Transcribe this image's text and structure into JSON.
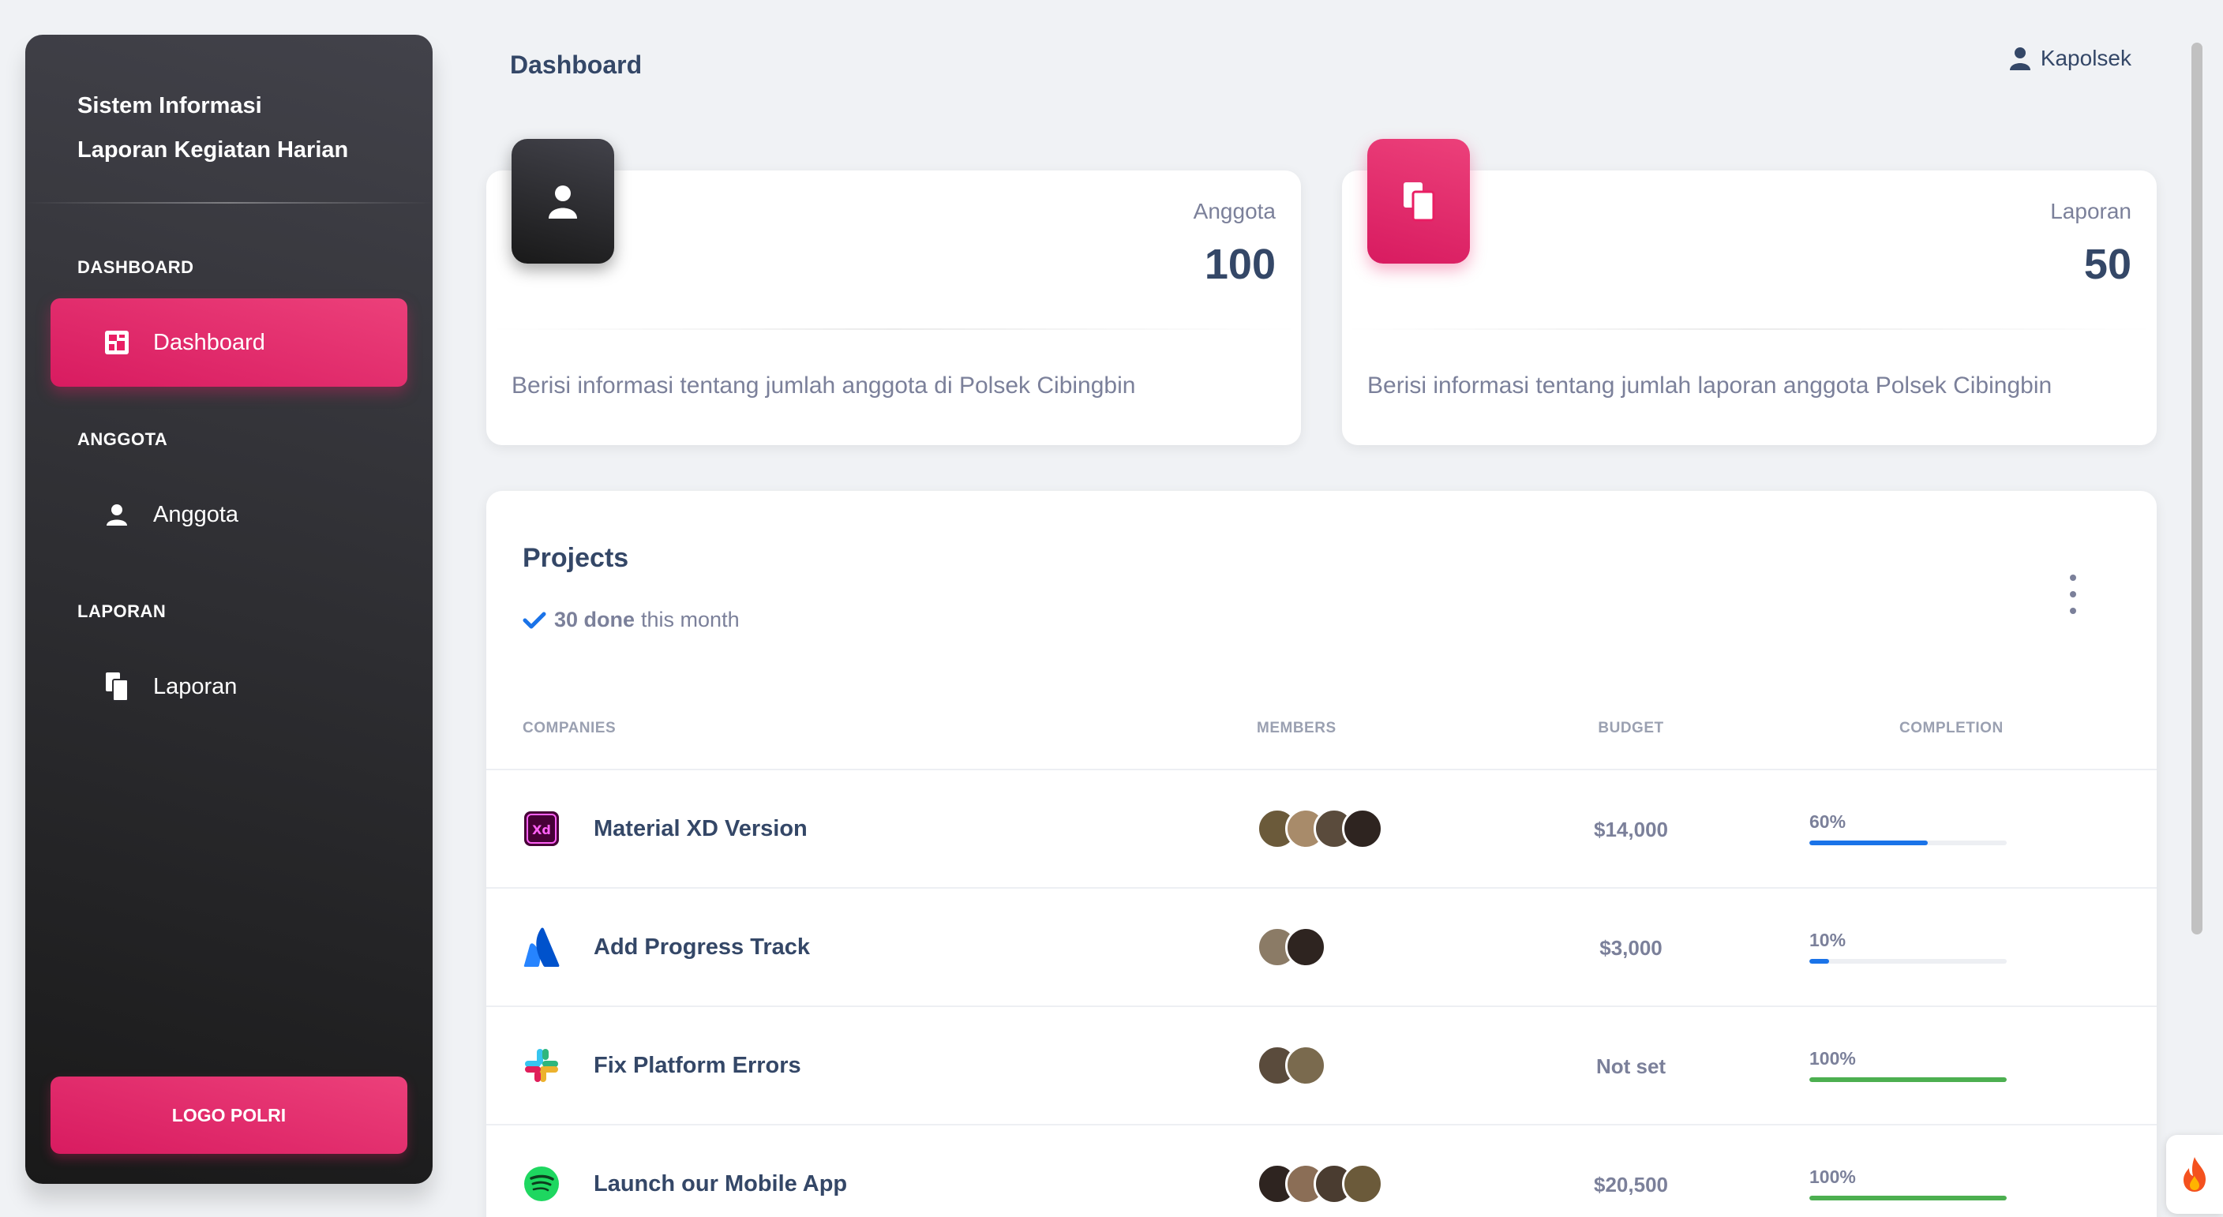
{
  "sidebar": {
    "brand_line1": "Sistem Informasi",
    "brand_line2": "Laporan Kegiatan Harian",
    "sections": [
      {
        "title": "DASHBOARD",
        "item": {
          "label": "Dashboard",
          "icon": "dashboard-icon",
          "active": true
        }
      },
      {
        "title": "ANGGOTA",
        "item": {
          "label": "Anggota",
          "icon": "person-icon",
          "active": false
        }
      },
      {
        "title": "LAPORAN",
        "item": {
          "label": "Laporan",
          "icon": "documents-icon",
          "active": false
        }
      }
    ],
    "footer_button": "LOGO POLRI"
  },
  "header": {
    "title": "Dashboard",
    "user": "Kapolsek",
    "user_icon": "person-icon"
  },
  "stats": [
    {
      "label": "Anggota",
      "value": "100",
      "description": "Berisi informasi tentang jumlah anggota di Polsek Cibingbin",
      "icon": "person-icon",
      "color": "#191919"
    },
    {
      "label": "Laporan",
      "value": "50",
      "description": "Berisi informasi tentang jumlah laporan anggota Polsek Cibingbin",
      "icon": "documents-icon",
      "color": "#e91e63"
    }
  ],
  "projects": {
    "title": "Projects",
    "subtitle_done": "30 done",
    "subtitle_rest": "this month",
    "columns": [
      "COMPANIES",
      "MEMBERS",
      "BUDGET",
      "COMPLETION"
    ],
    "rows": [
      {
        "name": "Material XD Version",
        "icon": "adobe-xd-icon",
        "members": 4,
        "budget": "$14,000",
        "completion_label": "60%",
        "completion": 60,
        "color": "#1a73e8"
      },
      {
        "name": "Add Progress Track",
        "icon": "atlassian-icon",
        "members": 2,
        "budget": "$3,000",
        "completion_label": "10%",
        "completion": 10,
        "color": "#1a73e8"
      },
      {
        "name": "Fix Platform Errors",
        "icon": "slack-icon",
        "members": 2,
        "budget": "Not set",
        "completion_label": "100%",
        "completion": 100,
        "color": "#4caf50"
      },
      {
        "name": "Launch our Mobile App",
        "icon": "spotify-icon",
        "members": 4,
        "budget": "$20,500",
        "completion_label": "100%",
        "completion": 100,
        "color": "#4caf50"
      }
    ]
  },
  "colors": {
    "accent": "#e91e63",
    "sidebar_dark": "#191919",
    "text": "#344767",
    "muted": "#7b809a"
  }
}
